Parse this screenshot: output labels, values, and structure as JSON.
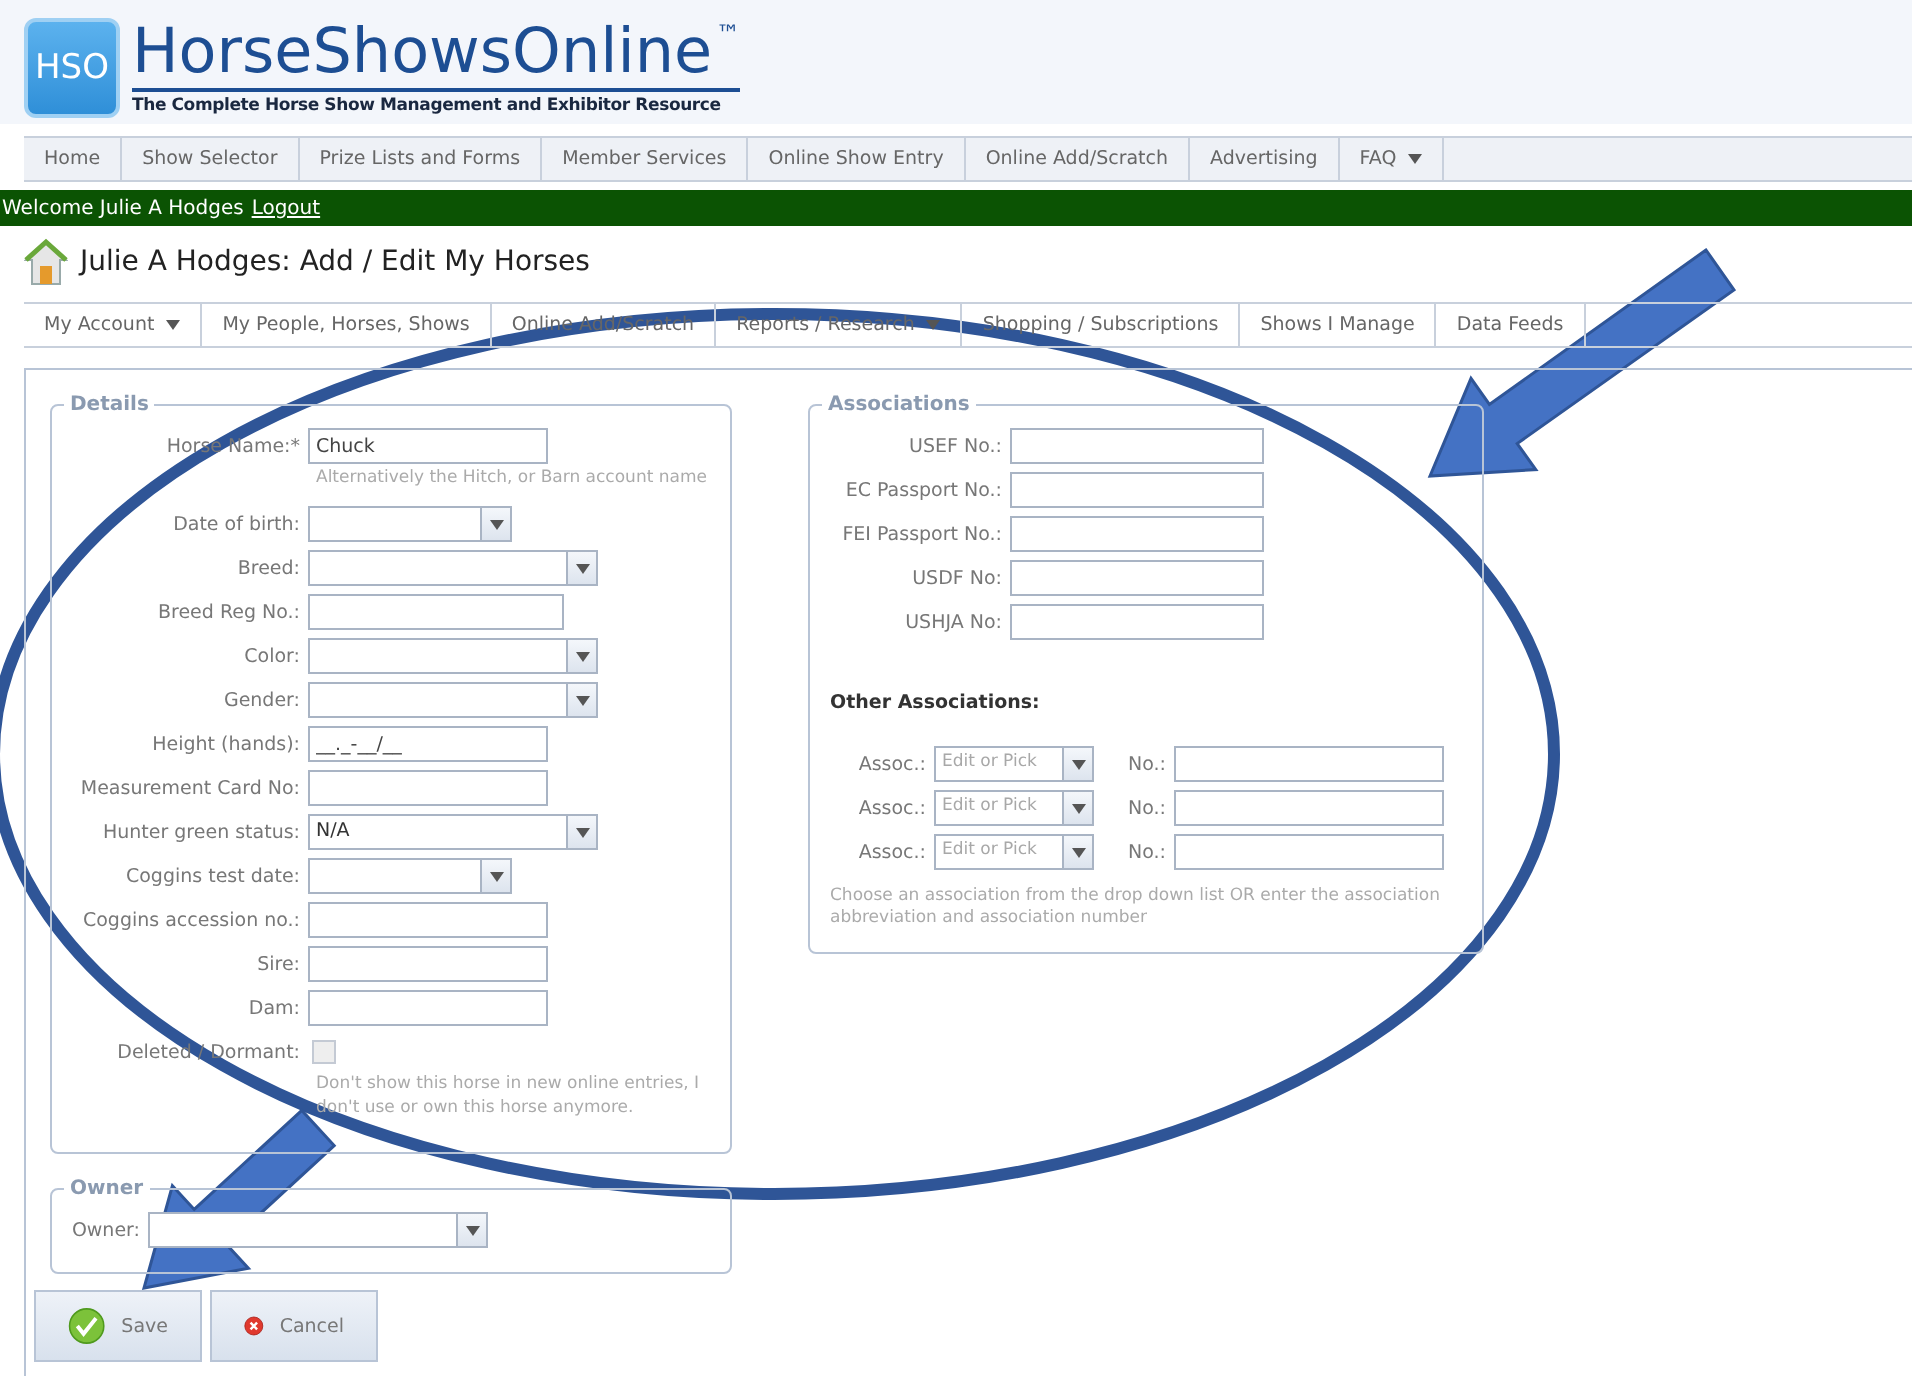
{
  "logo": {
    "badge": "HSO",
    "name": "HorseShowsOnline",
    "trademark": "™",
    "tagline": "The Complete Horse Show Management and Exhibitor Resource"
  },
  "top_nav": [
    {
      "label": "Home",
      "dropdown": false
    },
    {
      "label": "Show Selector",
      "dropdown": false
    },
    {
      "label": "Prize Lists and Forms",
      "dropdown": false
    },
    {
      "label": "Member Services",
      "dropdown": false
    },
    {
      "label": "Online Show Entry",
      "dropdown": false
    },
    {
      "label": "Online Add/Scratch",
      "dropdown": false
    },
    {
      "label": "Advertising",
      "dropdown": false
    },
    {
      "label": "FAQ",
      "dropdown": true
    }
  ],
  "welcome": {
    "text": "Welcome Julie A Hodges",
    "link": "Logout"
  },
  "page_title": "Julie A Hodges: Add / Edit My Horses",
  "sub_nav": [
    {
      "label": "My Account",
      "dropdown": true
    },
    {
      "label": "My People, Horses, Shows",
      "dropdown": false
    },
    {
      "label": "Online Add/Scratch",
      "dropdown": false
    },
    {
      "label": "Reports / Research",
      "dropdown": true
    },
    {
      "label": "Shopping / Subscriptions",
      "dropdown": false
    },
    {
      "label": "Shows I Manage",
      "dropdown": false
    },
    {
      "label": "Data Feeds",
      "dropdown": false
    }
  ],
  "details": {
    "legend": "Details",
    "fields": [
      {
        "label": "Horse Name:*",
        "kind": "text",
        "value": "Chuck",
        "hint": "Alternatively the Hitch, or Barn account name"
      },
      {
        "label": "Date of birth:",
        "kind": "date"
      },
      {
        "label": "Breed:",
        "kind": "select"
      },
      {
        "label": "Breed Reg No.:",
        "kind": "wide"
      },
      {
        "label": "Color:",
        "kind": "select"
      },
      {
        "label": "Gender:",
        "kind": "select"
      },
      {
        "label": "Height (hands):",
        "kind": "text",
        "value": "__._-__/__"
      },
      {
        "label": "Measurement Card No:",
        "kind": "text"
      },
      {
        "label": "Hunter green status:",
        "kind": "select",
        "value": "N/A"
      },
      {
        "label": "Coggins test date:",
        "kind": "date"
      },
      {
        "label": "Coggins accession no.:",
        "kind": "text"
      },
      {
        "label": "Sire:",
        "kind": "text"
      },
      {
        "label": "Dam:",
        "kind": "text"
      },
      {
        "label": "Deleted / Dormant:",
        "kind": "checkbox",
        "checked": false,
        "hint": "Don't show this horse in new online entries, I don't use or own this horse anymore."
      }
    ]
  },
  "owner": {
    "legend": "Owner",
    "label": "Owner:"
  },
  "associations": {
    "legend": "Associations",
    "fields": [
      {
        "label": "USEF No.:"
      },
      {
        "label": "EC Passport No.:"
      },
      {
        "label": "FEI Passport No.:"
      },
      {
        "label": "USDF No:"
      },
      {
        "label": "USHJA No:"
      }
    ],
    "other_title": "Other Associations:",
    "rows": [
      {
        "assoc_label": "Assoc.:",
        "placeholder": "Edit or Pick",
        "no_label": "No.:"
      },
      {
        "assoc_label": "Assoc.:",
        "placeholder": "Edit or Pick",
        "no_label": "No.:"
      },
      {
        "assoc_label": "Assoc.:",
        "placeholder": "Edit or Pick",
        "no_label": "No.:"
      }
    ],
    "note": "Choose an association from the drop down list OR enter the association abbreviation and association number"
  },
  "buttons": [
    {
      "label": "Save",
      "kind": "save"
    },
    {
      "label": "Cancel",
      "kind": "cancel"
    }
  ]
}
